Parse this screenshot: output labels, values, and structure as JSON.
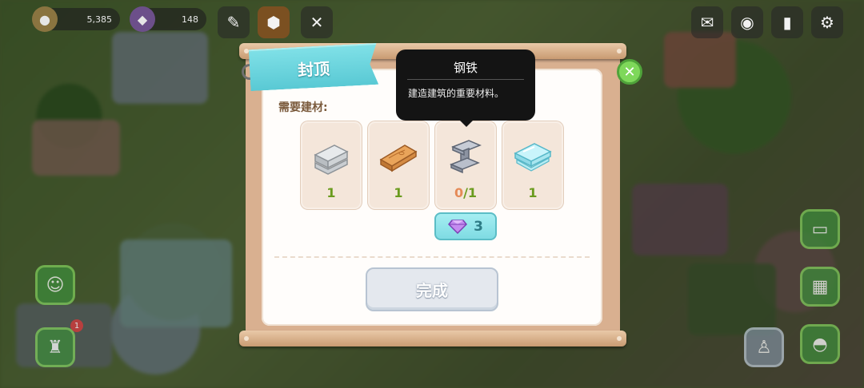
{
  "hud": {
    "coins": "5,385",
    "gems": "148"
  },
  "panel": {
    "title": "封顶",
    "need_label": "需要建材:",
    "materials": [
      {
        "name": "concrete-slabs",
        "have": "1",
        "required": null
      },
      {
        "name": "wood-planks",
        "have": "1",
        "required": null
      },
      {
        "name": "steel-beam",
        "have": "0",
        "required": "1"
      },
      {
        "name": "glass-panes",
        "have": "1",
        "required": null
      }
    ],
    "gem_cost": "3",
    "done_label": "完成"
  },
  "tooltip": {
    "title": "钢铁",
    "description": "建造建筑的重要材料。"
  },
  "side_badge": "1",
  "colors": {
    "ribbon": "#59c9d4",
    "close_button": "#7ed85a",
    "qty_ok": "#6a9b1e",
    "qty_short": "#e58a57",
    "gem_button": "#7fdbe3",
    "done_button": "#e4e8ee"
  }
}
